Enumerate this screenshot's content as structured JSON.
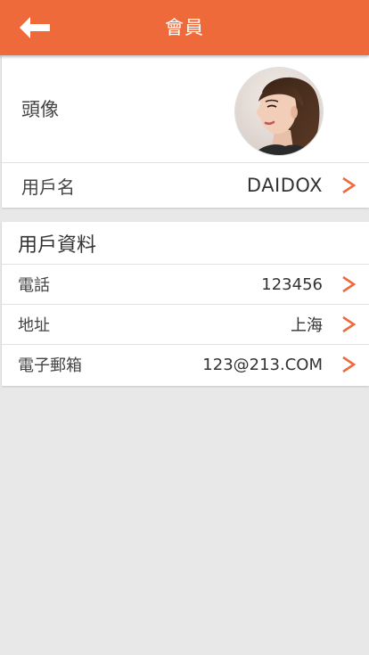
{
  "header": {
    "title": "會員",
    "back_icon": "arrow-left-icon",
    "background_color": "#ee6a3a"
  },
  "profile": {
    "avatar_label": "頭像",
    "username_label": "用戶名",
    "username_value": "DAIDOX"
  },
  "user_info": {
    "section_title": "用戶資料",
    "rows": [
      {
        "label": "電話",
        "value": "123456"
      },
      {
        "label": "地址",
        "value": "上海"
      },
      {
        "label": "電子郵箱",
        "value": "123@213.COM"
      }
    ]
  },
  "chevron_icon": "chevron-right-icon",
  "accent_color": "#ee6a3a"
}
